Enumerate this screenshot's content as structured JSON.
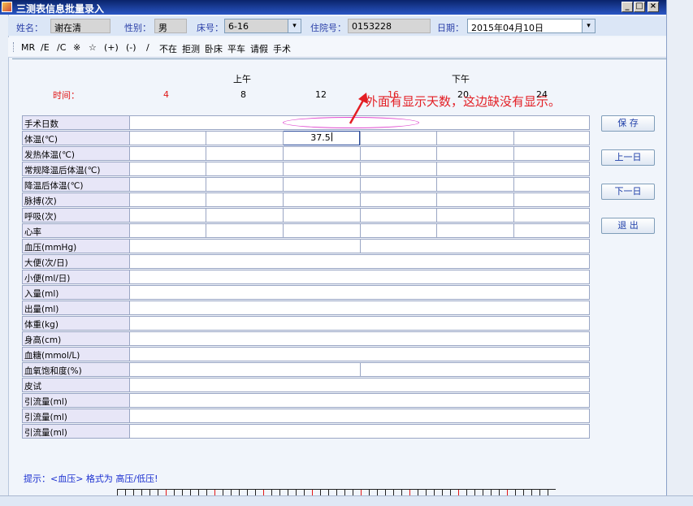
{
  "window": {
    "title": "三测表信息批量录入",
    "min_glyph": "_",
    "max_glyph": "□",
    "close_glyph": "×"
  },
  "info": {
    "name_label": "姓名：",
    "name_value": "谢在清",
    "sex_label": "性别：",
    "sex_value": "男",
    "bed_label": "床号：",
    "bed_value": "6-16",
    "admission_label": "住院号：",
    "admission_value": "0153228",
    "date_label": "日期：",
    "date_value": "2015年04月10日",
    "dropdown_glyph": "▾"
  },
  "symbols": [
    "MR",
    "/E",
    "/C",
    "※",
    "☆",
    "(+)",
    "(-)",
    "/",
    "不在",
    "拒测",
    "卧床",
    "平车",
    "请假",
    "手术"
  ],
  "header": {
    "am": "上午",
    "pm": "下午",
    "time_label": "时间：",
    "times": [
      "4",
      "8",
      "12",
      "16",
      "20",
      "24"
    ]
  },
  "rows": [
    "手术日数",
    "体温(℃)",
    "发热体温(℃)",
    "常规降温后体温(℃)",
    "降温后体温(℃)",
    "脉搏(次)",
    "呼吸(次)",
    "心率",
    "血压(mmHg)",
    "大便(次/日)",
    "小便(ml/日)",
    "入量(ml)",
    "出量(ml)",
    "体重(kg)",
    "身高(cm)",
    "血糖(mmol/L)",
    "血氧饱和度(%)",
    "皮试",
    "引流量(ml)",
    "引流量(ml)",
    "引流量(ml)"
  ],
  "cells": {
    "temperature_12": "37.5"
  },
  "buttons": {
    "save": "保 存",
    "prev_day": "上一日",
    "next_day": "下一日",
    "exit": "退 出"
  },
  "hint": "提示：<血压> 格式为 高压/低压!",
  "annotation": "外面有显示天数，这边缺没有显示。",
  "colors": {
    "accent": "#2a3fa8",
    "annotation": "#e31e24",
    "time_red": "#e01818"
  }
}
